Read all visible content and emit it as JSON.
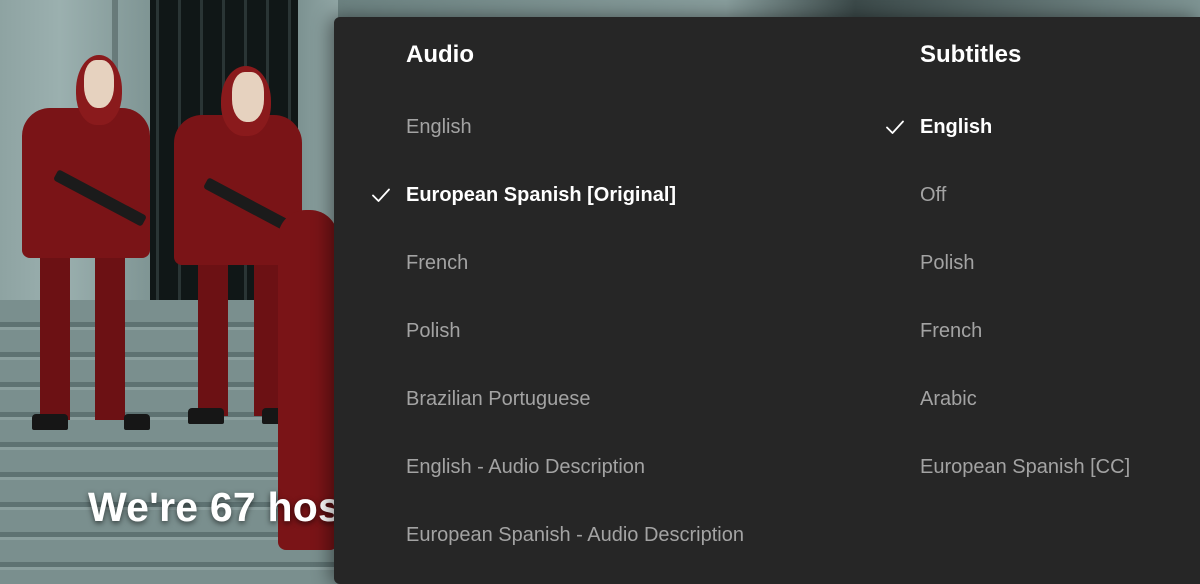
{
  "video": {
    "caption": "We're 67 hos"
  },
  "panel": {
    "audio": {
      "heading": "Audio",
      "options": [
        {
          "label": "English",
          "selected": false
        },
        {
          "label": "European Spanish [Original]",
          "selected": true
        },
        {
          "label": "French",
          "selected": false
        },
        {
          "label": "Polish",
          "selected": false
        },
        {
          "label": "Brazilian Portuguese",
          "selected": false
        },
        {
          "label": "English - Audio Description",
          "selected": false
        },
        {
          "label": "European Spanish - Audio Description",
          "selected": false
        }
      ]
    },
    "subtitles": {
      "heading": "Subtitles",
      "options": [
        {
          "label": "English",
          "selected": true
        },
        {
          "label": "Off",
          "selected": false
        },
        {
          "label": "Polish",
          "selected": false
        },
        {
          "label": "French",
          "selected": false
        },
        {
          "label": "Arabic",
          "selected": false
        },
        {
          "label": "European Spanish [CC]",
          "selected": false
        }
      ]
    }
  },
  "colors": {
    "panel_bg": "#262626",
    "selected_text": "#ffffff",
    "unselected_text": "#a3a3a3",
    "costume_red": "#7a1417"
  },
  "icons": {
    "selected_marker": "check-icon"
  }
}
